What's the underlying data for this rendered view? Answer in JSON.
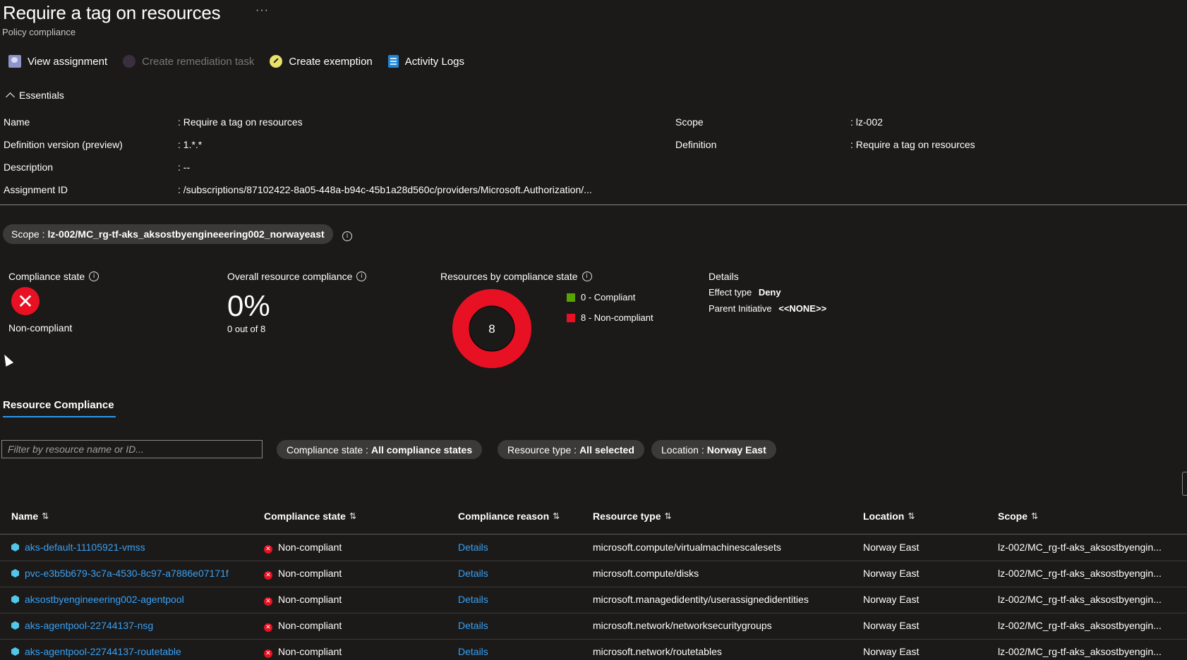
{
  "header": {
    "title": "Require a tag on resources",
    "more": "···",
    "subtitle": "Policy compliance"
  },
  "toolbar": {
    "view_assignment": "View assignment",
    "create_remediation": "Create remediation task",
    "create_exemption": "Create exemption",
    "activity_logs": "Activity Logs"
  },
  "essentials": {
    "heading": "Essentials",
    "left": [
      {
        "label": "Name",
        "value": ": Require a tag on resources"
      },
      {
        "label": "Definition version (preview)",
        "value": ": 1.*.*"
      },
      {
        "label": "Description",
        "value": ": --"
      },
      {
        "label": "Assignment ID",
        "value": ": /subscriptions/87102422-8a05-448a-b94c-45b1a28d560c/providers/Microsoft.Authorization/..."
      }
    ],
    "right": [
      {
        "label": "Scope",
        "value": ": lz-002"
      },
      {
        "label": "Definition",
        "value": ": Require a tag on resources"
      }
    ]
  },
  "scope_pill": {
    "label": "Scope :",
    "value": "lz-002/MC_rg-tf-aks_aksostbyengineeering002_norwayeast"
  },
  "summary": {
    "compliance_state_label": "Compliance state",
    "compliance_state_value": "Non-compliant",
    "overall_label": "Overall resource compliance",
    "overall_percent": "0%",
    "overall_sub": "0 out of 8",
    "by_state_label": "Resources by compliance state",
    "donut_total": "8",
    "compliant_count": 0,
    "noncompliant_count": 8,
    "legend_compliant": "0 - Compliant",
    "legend_noncompliant": "8 - Non-compliant",
    "compliant_color": "#57a300",
    "noncompliant_color": "#e81123",
    "details_label": "Details",
    "effect_type_label": "Effect type",
    "effect_type_value": "Deny",
    "parent_initiative_label": "Parent Initiative",
    "parent_initiative_value": "<<NONE>>"
  },
  "tab": {
    "label": "Resource Compliance"
  },
  "filters": {
    "search_placeholder": "Filter by resource name or ID...",
    "compliance_state": {
      "label": "Compliance state :",
      "value": "All compliance states"
    },
    "resource_type": {
      "label": "Resource type :",
      "value": "All selected"
    },
    "location": {
      "label": "Location :",
      "value": "Norway East"
    }
  },
  "table": {
    "columns": [
      "Name",
      "Compliance state",
      "Compliance reason",
      "Resource type",
      "Location",
      "Scope"
    ],
    "sort_glyph": "⇅",
    "rows": [
      {
        "name": "aks-default-11105921-vmss",
        "state": "Non-compliant",
        "reason": "Details",
        "type": "microsoft.compute/virtualmachinescalesets",
        "location": "Norway East",
        "scope": "lz-002/MC_rg-tf-aks_aksostbyengin..."
      },
      {
        "name": "pvc-e3b5b679-3c7a-4530-8c97-a7886e07171f",
        "state": "Non-compliant",
        "reason": "Details",
        "type": "microsoft.compute/disks",
        "location": "Norway East",
        "scope": "lz-002/MC_rg-tf-aks_aksostbyengin..."
      },
      {
        "name": "aksostbyengineeering002-agentpool",
        "state": "Non-compliant",
        "reason": "Details",
        "type": "microsoft.managedidentity/userassignedidentities",
        "location": "Norway East",
        "scope": "lz-002/MC_rg-tf-aks_aksostbyengin..."
      },
      {
        "name": "aks-agentpool-22744137-nsg",
        "state": "Non-compliant",
        "reason": "Details",
        "type": "microsoft.network/networksecuritygroups",
        "location": "Norway East",
        "scope": "lz-002/MC_rg-tf-aks_aksostbyengin..."
      },
      {
        "name": "aks-agentpool-22744137-routetable",
        "state": "Non-compliant",
        "reason": "Details",
        "type": "microsoft.network/routetables",
        "location": "Norway East",
        "scope": "lz-002/MC_rg-tf-aks_aksostbyengin..."
      }
    ]
  }
}
